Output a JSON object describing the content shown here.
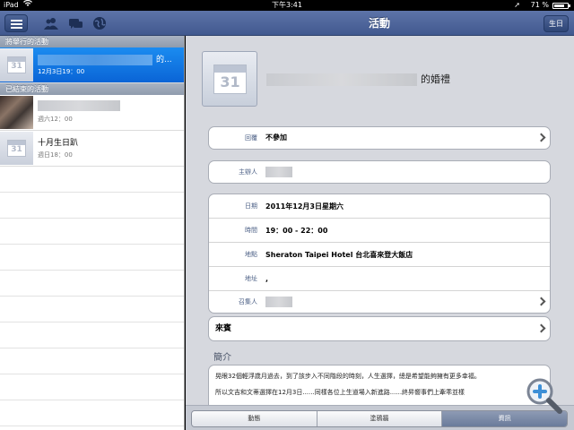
{
  "status_bar": {
    "carrier": "iPad",
    "time": "下午3:41",
    "battery": "71 %"
  },
  "nav": {
    "title": "活動",
    "birthday_button": "生日"
  },
  "left": {
    "upcoming_header": "將舉行的活動",
    "upcoming": [
      {
        "suffix": "的...",
        "time": "12月3日19：00"
      }
    ],
    "past_header": "已結束的活動",
    "past": [
      {
        "title": "",
        "time": "週六12：00"
      },
      {
        "title": "十月生日趴",
        "time": "週日18：00"
      }
    ]
  },
  "detail": {
    "title_suffix": "的婚禮",
    "rsvp": {
      "label": "回覆",
      "value": "不參加"
    },
    "host": {
      "label": "主辦人"
    },
    "info": {
      "date_label": "日期",
      "date": "2011年12月3日星期六",
      "time_label": "時間",
      "time": "19：00 - 22：00",
      "place_label": "地點",
      "place": "Sheraton Taipei Hotel 台北喜來登大飯店",
      "address_label": "地址",
      "address": ",",
      "organizer_label": "召集人"
    },
    "guests_label": "來賓",
    "intro_header": "簡介",
    "intro_lines": [
      "晃眼32個輕浮歲月過去，到了該步入不同階段的時刻，人生選擇，總是希望能夠擁有更多幸福。",
      "所以文吉和文蒂選擇在12月3日......同樣各位上生道場入新進路......終昇嚮事們上牽乖並樣"
    ]
  },
  "segments": [
    "動態",
    "塗鴉牆",
    "資訊"
  ],
  "active_segment": 2,
  "colors": {
    "navbar": "#4f679c",
    "selected_row": "#1578e6",
    "label_blue": "#4b5f85"
  }
}
